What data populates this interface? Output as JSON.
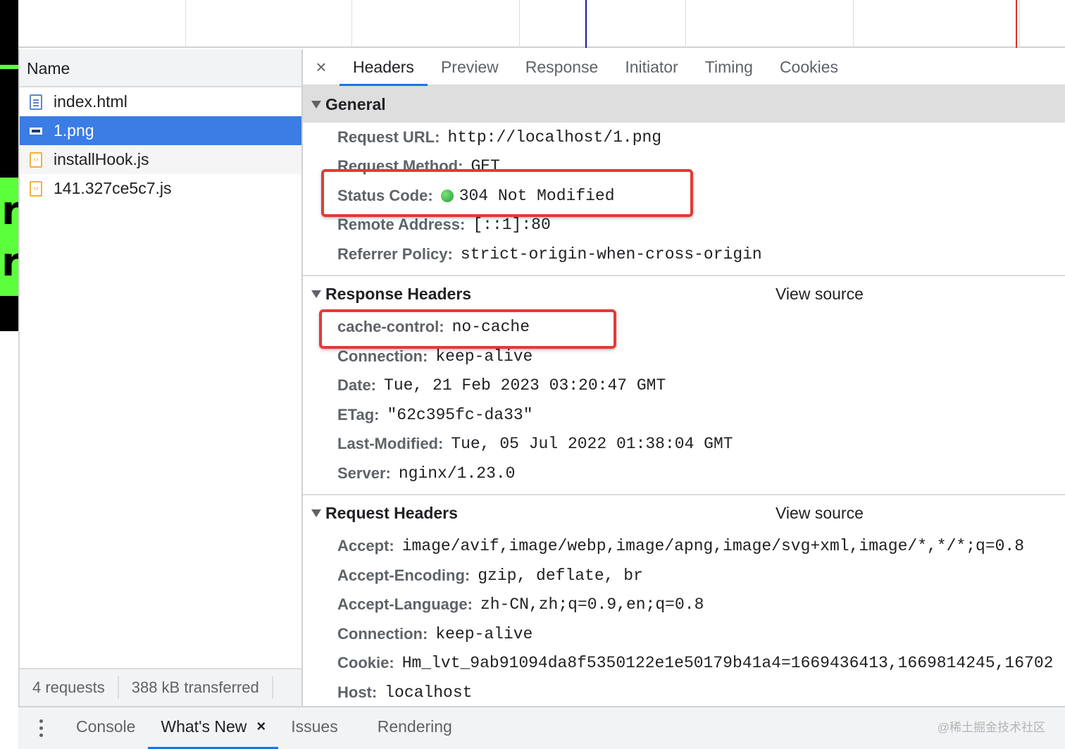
{
  "background_page": {
    "glyph_top": "r",
    "glyph_bottom": "r"
  },
  "request_list": {
    "column_name": "Name",
    "rows": [
      {
        "name": "index.html",
        "icon": "document-icon"
      },
      {
        "name": "1.png",
        "icon": "image-icon",
        "selected": true
      },
      {
        "name": "installHook.js",
        "icon": "script-icon"
      },
      {
        "name": "141.327ce5c7.js",
        "icon": "script-icon"
      }
    ],
    "summary": {
      "requests": "4 requests",
      "transferred": "388 kB transferred"
    }
  },
  "tabs": {
    "close": "×",
    "items": [
      "Headers",
      "Preview",
      "Response",
      "Initiator",
      "Timing",
      "Cookies"
    ],
    "active": "Headers"
  },
  "general": {
    "title": "General",
    "request_url": {
      "key": "Request URL:",
      "value": "http://localhost/1.png"
    },
    "request_method": {
      "key": "Request Method:",
      "value": "GET"
    },
    "status_code": {
      "key": "Status Code:",
      "value": "304 Not Modified",
      "status_color": "#34a853"
    },
    "remote_address": {
      "key": "Remote Address:",
      "value": "[::1]:80"
    },
    "referrer_policy": {
      "key": "Referrer Policy:",
      "value": "strict-origin-when-cross-origin"
    }
  },
  "response_headers": {
    "title": "Response Headers",
    "view_source": "View source",
    "items": [
      {
        "key": "cache-control:",
        "value": "no-cache"
      },
      {
        "key": "Connection:",
        "value": "keep-alive"
      },
      {
        "key": "Date:",
        "value": "Tue, 21 Feb 2023 03:20:47 GMT"
      },
      {
        "key": "ETag:",
        "value": "\"62c395fc-da33\""
      },
      {
        "key": "Last-Modified:",
        "value": "Tue, 05 Jul 2022 01:38:04 GMT"
      },
      {
        "key": "Server:",
        "value": "nginx/1.23.0"
      }
    ]
  },
  "request_headers": {
    "title": "Request Headers",
    "view_source": "View source",
    "items": [
      {
        "key": "Accept:",
        "value": "image/avif,image/webp,image/apng,image/svg+xml,image/*,*/*;q=0.8"
      },
      {
        "key": "Accept-Encoding:",
        "value": "gzip, deflate, br"
      },
      {
        "key": "Accept-Language:",
        "value": "zh-CN,zh;q=0.9,en;q=0.8"
      },
      {
        "key": "Connection:",
        "value": "keep-alive"
      },
      {
        "key": "Cookie:",
        "value": "Hm_lvt_9ab91094da8f5350122e1e50179b41a4=1669436413,1669814245,16702"
      },
      {
        "key": "Host:",
        "value": "localhost"
      }
    ]
  },
  "drawer": {
    "tabs": [
      "Console",
      "What's New",
      "Issues",
      "Rendering"
    ],
    "active": "What's New",
    "close": "×"
  },
  "watermark": "@稀土掘金技术社区",
  "colors": {
    "selection": "#3b7ce5",
    "accent": "#1a73e8",
    "highlight": "#e53935"
  }
}
